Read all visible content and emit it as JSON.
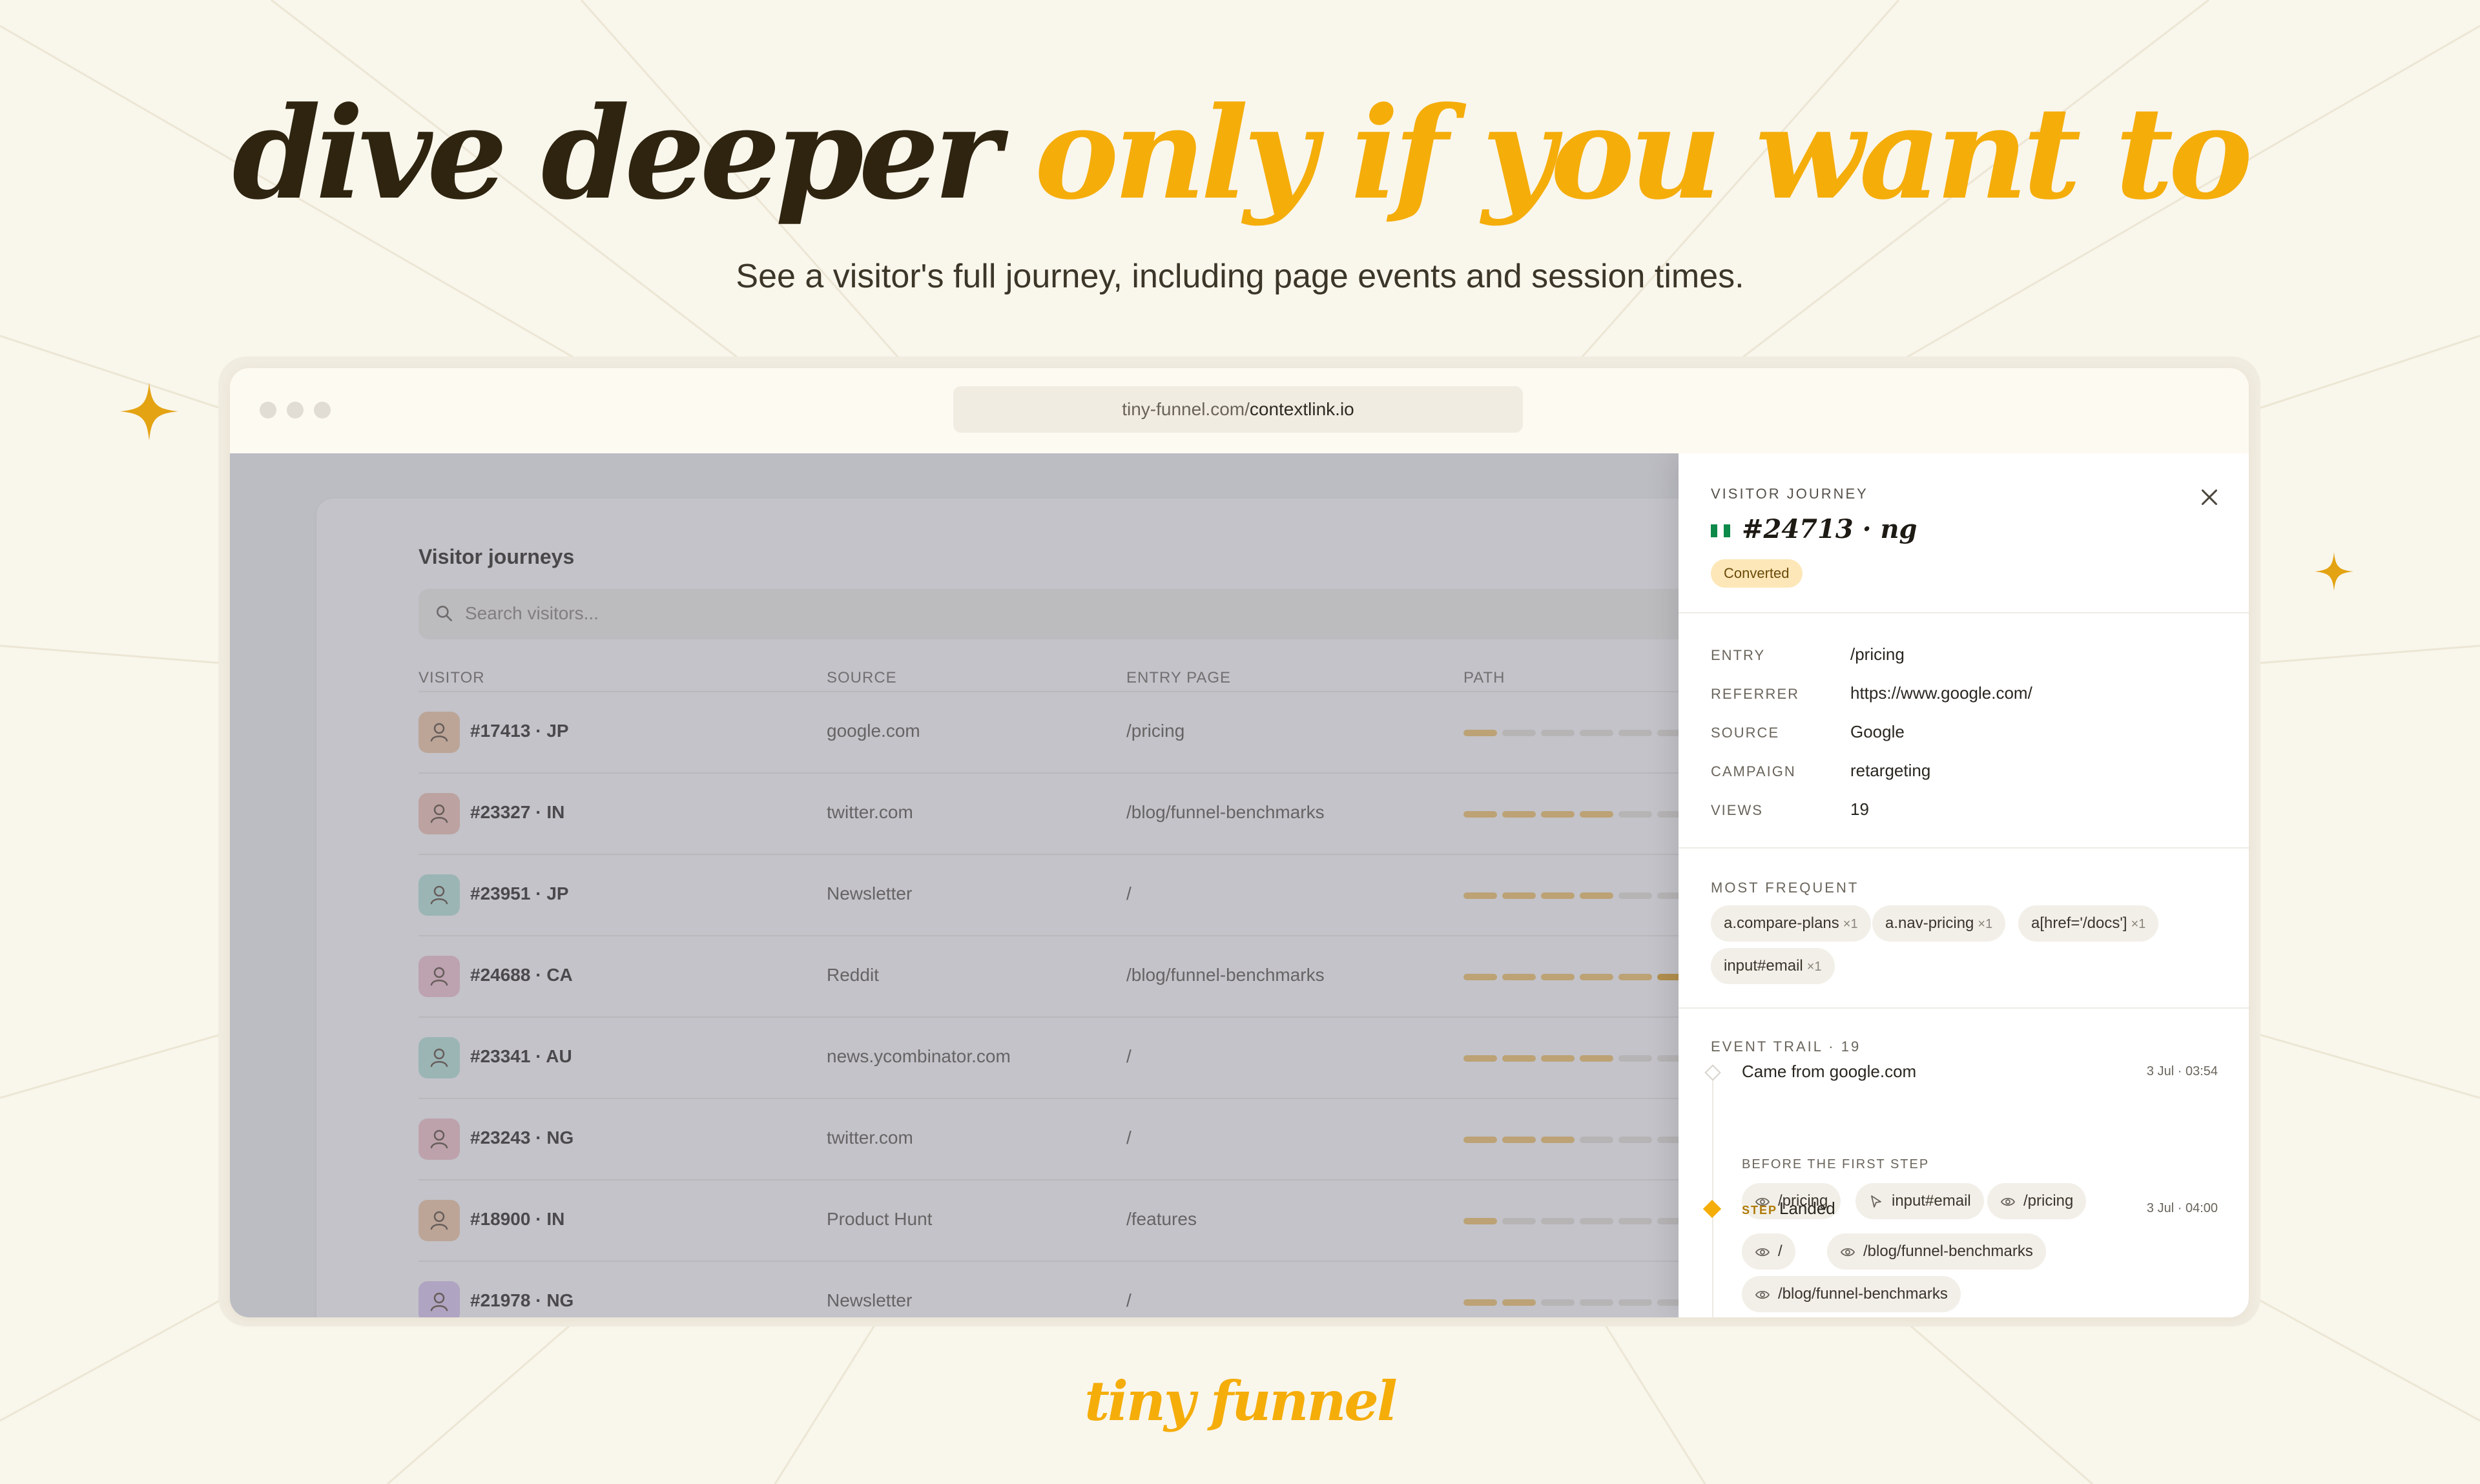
{
  "headline": {
    "dark": "dive deeper",
    "accent": "only if you want to"
  },
  "subtitle": "See a visitor's full journey, including page events and session times.",
  "browser": {
    "url_prefix": "tiny-funnel.com/",
    "url_path": "contextlink.io"
  },
  "table": {
    "title": "Visitor journeys",
    "search_placeholder": "Search visitors...",
    "columns": [
      "VISITOR",
      "SOURCE",
      "ENTRY PAGE",
      "PATH"
    ],
    "rows": [
      {
        "visitor": "#17413 · JP",
        "source": "google.com",
        "entry": "/pricing",
        "avatar_color": "#f3c9a6",
        "path_filled": 1,
        "path_strong": 0
      },
      {
        "visitor": "#23327 · IN",
        "source": "twitter.com",
        "entry": "/blog/funnel-benchmarks",
        "avatar_color": "#f3c4b6",
        "path_filled": 4,
        "path_strong": 0
      },
      {
        "visitor": "#23951 · JP",
        "source": "Newsletter",
        "entry": "/",
        "avatar_color": "#b8e6dc",
        "path_filled": 4,
        "path_strong": 0
      },
      {
        "visitor": "#24688 · CA",
        "source": "Reddit",
        "entry": "/blog/funnel-benchmarks",
        "avatar_color": "#f4c4d2",
        "path_filled": 7,
        "path_strong": 2
      },
      {
        "visitor": "#23341 · AU",
        "source": "news.ycombinator.com",
        "entry": "/",
        "avatar_color": "#b8e6dc",
        "path_filled": 4,
        "path_strong": 0
      },
      {
        "visitor": "#23243 · NG",
        "source": "twitter.com",
        "entry": "/",
        "avatar_color": "#f4c4cc",
        "path_filled": 3,
        "path_strong": 0
      },
      {
        "visitor": "#18900 · IN",
        "source": "Product Hunt",
        "entry": "/features",
        "avatar_color": "#f3c9a6",
        "path_filled": 1,
        "path_strong": 0
      },
      {
        "visitor": "#21978 · NG",
        "source": "Newsletter",
        "entry": "/",
        "avatar_color": "#dcc8f0",
        "path_filled": 2,
        "path_strong": 0
      }
    ]
  },
  "drawer": {
    "eyebrow": "VISITOR JOURNEY",
    "visitor_id": "#24713 · ng",
    "status": "Converted",
    "details": [
      {
        "key": "ENTRY",
        "value": "/pricing"
      },
      {
        "key": "REFERRER",
        "value": "https://www.google.com/"
      },
      {
        "key": "SOURCE",
        "value": "Google"
      },
      {
        "key": "CAMPAIGN",
        "value": "retargeting"
      },
      {
        "key": "VIEWS",
        "value": "19"
      }
    ],
    "most_frequent_title": "MOST FREQUENT",
    "most_frequent": [
      {
        "label": "a.compare-plans",
        "count": "×1"
      },
      {
        "label": "a.nav-pricing",
        "count": "×1"
      },
      {
        "label": "a[href='/docs']",
        "count": "×1"
      },
      {
        "label": "input#email",
        "count": "×1"
      }
    ],
    "trail_title": "EVENT TRAIL · 19",
    "trail": {
      "first_title": "Came from google.com",
      "first_time": "3 Jul · 03:54",
      "before_label": "BEFORE THE FIRST STEP",
      "before_events": [
        {
          "icon": "eye",
          "label": "/pricing"
        },
        {
          "icon": "cursor",
          "label": "input#email"
        },
        {
          "icon": "eye",
          "label": "/pricing"
        }
      ],
      "step_tag": "STEP",
      "step_title": "Landed",
      "step_time": "3 Jul · 04:00",
      "step_events": [
        {
          "icon": "eye",
          "label": "/"
        },
        {
          "icon": "eye",
          "label": "/blog/funnel-benchmarks"
        },
        {
          "icon": "eye",
          "label": "/blog/funnel-benchmarks"
        }
      ]
    }
  },
  "brand": "tiny funnel",
  "colors": {
    "accent": "#f5ad0a",
    "dark": "#2e2410",
    "background": "#f9f6ec"
  }
}
